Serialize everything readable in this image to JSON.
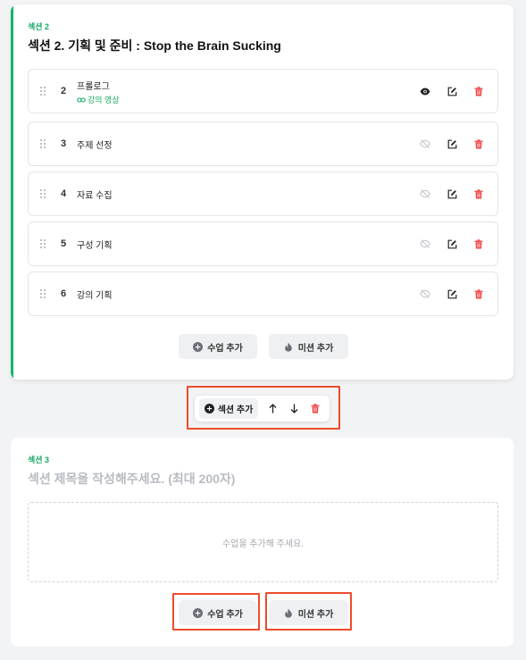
{
  "section2": {
    "label": "섹션 2",
    "title": "섹션 2. 기획 및 준비 : Stop the Brain Sucking",
    "lessons": [
      {
        "num": "2",
        "title": "프롤로그",
        "sub": "강의 영상",
        "visible": true
      },
      {
        "num": "3",
        "title": "주제 선정",
        "visible": false
      },
      {
        "num": "4",
        "title": "자료 수집",
        "visible": false
      },
      {
        "num": "5",
        "title": "구성 기획",
        "visible": false
      },
      {
        "num": "6",
        "title": "강의 기획",
        "visible": false
      }
    ],
    "add_lesson_label": "수업 추가",
    "add_mission_label": "미션 추가"
  },
  "toolbar": {
    "add_section_label": "섹션 추가"
  },
  "section3": {
    "label": "섹션 3",
    "title_placeholder": "섹션 제목을 작성해주세요. (최대 200자)",
    "empty_message": "수업을 추가해 주세요.",
    "add_lesson_label": "수업 추가",
    "add_mission_label": "미션 추가"
  },
  "colors": {
    "accent": "#16b36a",
    "delete": "#ef4444",
    "highlight": "#ee4b2b"
  },
  "icons": {
    "drag": "drag-handle-icon",
    "eye": "eye-icon",
    "eye_off": "eye-off-icon",
    "edit": "edit-icon",
    "delete": "trash-icon",
    "add": "plus-circle-icon",
    "mission": "flame-icon",
    "up": "arrow-up-icon",
    "down": "arrow-down-icon",
    "link": "link-icon"
  }
}
